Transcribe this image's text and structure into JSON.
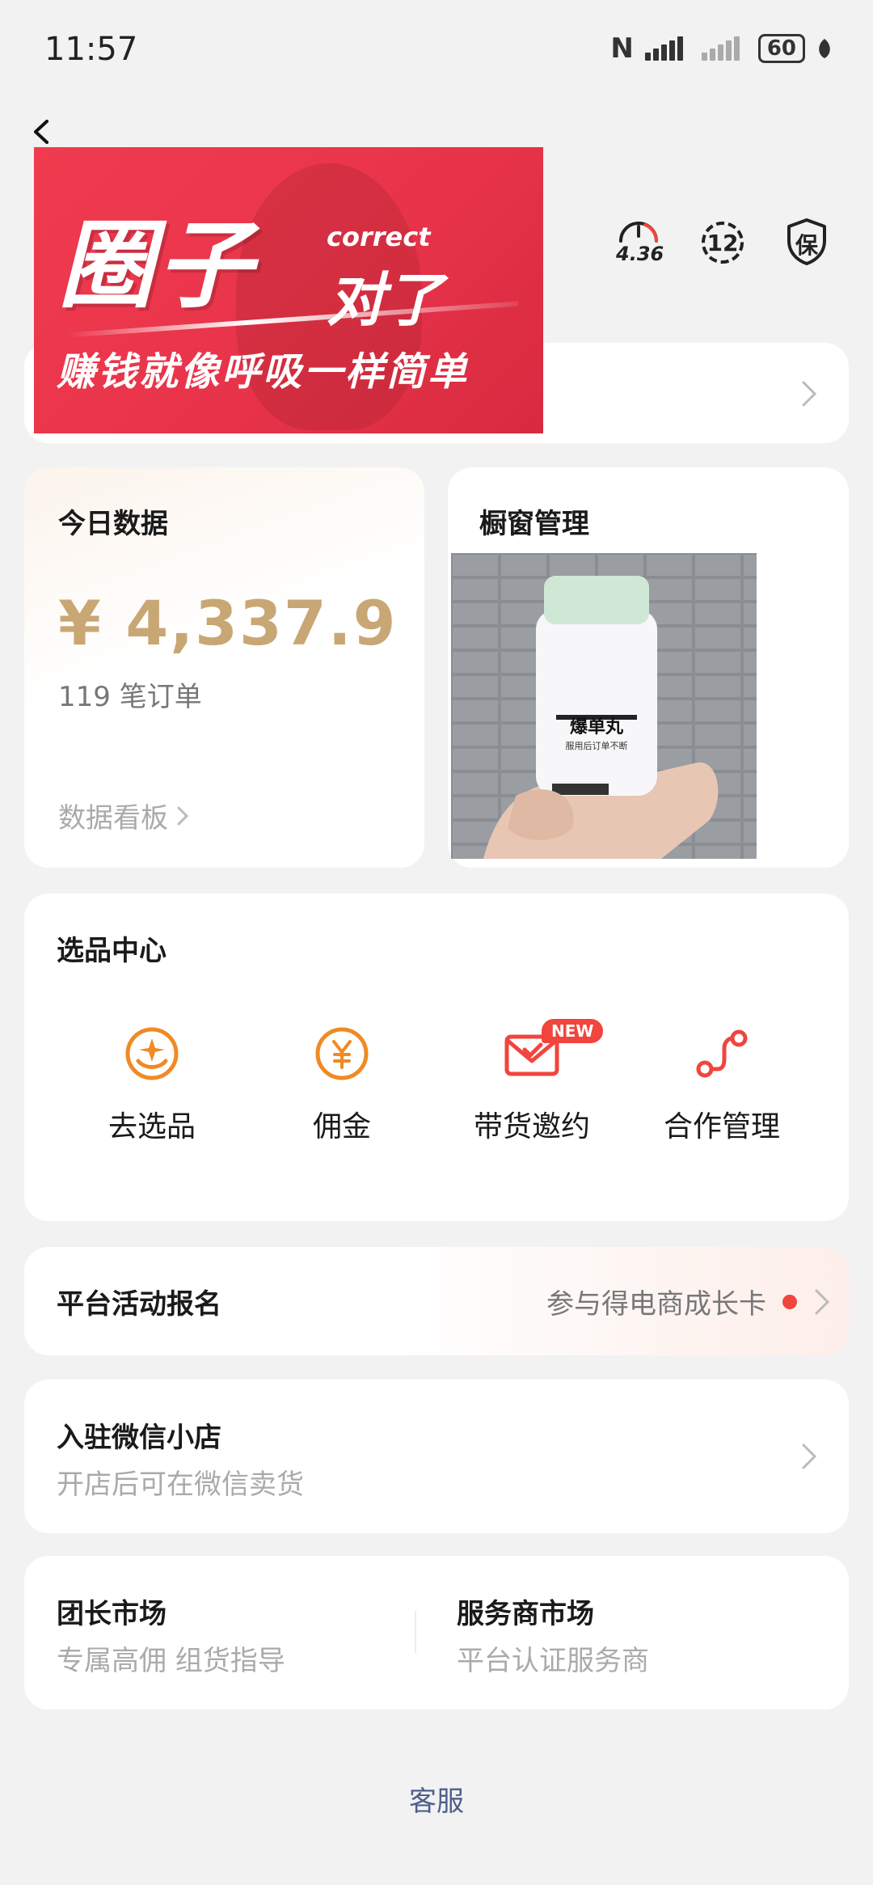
{
  "status_bar": {
    "time": "11:57",
    "nfc": "N",
    "battery": "60"
  },
  "banner": {
    "big_text": "圈子",
    "correct": "correct",
    "duile": "对了",
    "slogan": "赚钱就像呼吸一样简单"
  },
  "header": {
    "speed_value": "4.36",
    "level_value": "12",
    "insure_label": "保"
  },
  "today": {
    "title": "今日数据",
    "amount": "¥ 4,337.9",
    "orders": "119 笔订单",
    "board_link": "数据看板"
  },
  "window": {
    "title": "橱窗管理",
    "product": {
      "name": "爆单丸",
      "desc": "服用后订单不断"
    }
  },
  "select_center": {
    "title": "选品中心",
    "badge": "NEW",
    "items": [
      {
        "label": "去选品",
        "icon": "select-product-icon"
      },
      {
        "label": "佣金",
        "icon": "yuan-coin-icon"
      },
      {
        "label": "带货邀约",
        "icon": "invite-mail-icon"
      },
      {
        "label": "合作管理",
        "icon": "cooperation-path-icon"
      }
    ]
  },
  "activity": {
    "title": "平台活动报名",
    "right_text": "参与得电商成长卡"
  },
  "shop": {
    "title": "入驻微信小店",
    "subtitle": "开店后可在微信卖货"
  },
  "market": {
    "left_title": "团长市场",
    "left_sub": "专属高佣 组货指导",
    "right_title": "服务商市场",
    "right_sub": "平台认证服务商"
  },
  "footer": {
    "service": "客服"
  },
  "colors": {
    "accent_gold": "#c8a775",
    "orange": "#f08a24",
    "red": "#f1453d",
    "banner_red": "#e8344a",
    "link_blue": "#4d5f8c"
  }
}
